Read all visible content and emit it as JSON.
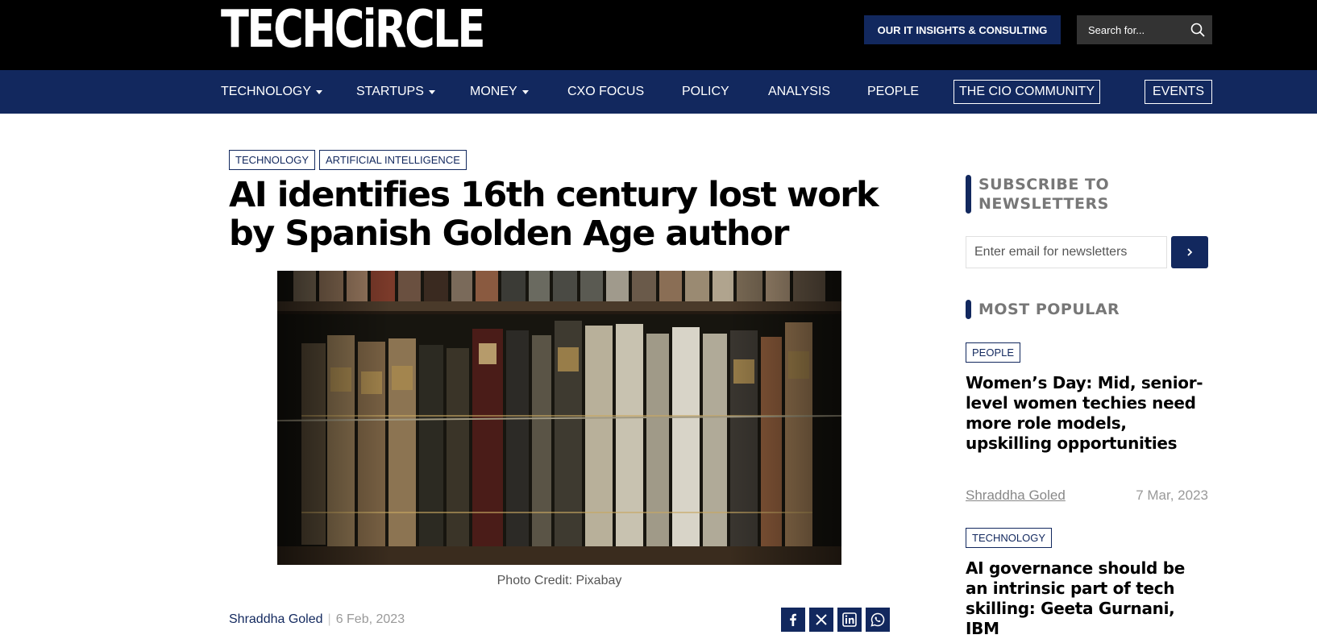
{
  "header": {
    "logo": "TECHCiRCLE",
    "insights_button": "OUR IT INSIGHTS & CONSULTING",
    "search_placeholder": "Search for..."
  },
  "nav": {
    "items": [
      {
        "label": "TECHNOLOGY",
        "dropdown": true
      },
      {
        "label": "STARTUPS",
        "dropdown": true
      },
      {
        "label": "MONEY",
        "dropdown": true
      },
      {
        "label": "CXO FOCUS"
      },
      {
        "label": "POLICY"
      },
      {
        "label": "ANALYSIS"
      },
      {
        "label": "PEOPLE"
      }
    ],
    "cio_community": "THE CIO COMMUNITY",
    "events": "EVENTS"
  },
  "article": {
    "tags": [
      "TECHNOLOGY",
      "ARTIFICIAL INTELLIGENCE"
    ],
    "headline": "AI identifies 16th century lost work by Spanish Golden Age author",
    "photo_credit": "Photo Credit: Pixabay",
    "author": "Shraddha Goled",
    "date": "6 Feb, 2023",
    "share_icons": [
      "facebook-icon",
      "x-icon",
      "linkedin-icon",
      "whatsapp-icon"
    ]
  },
  "sidebar": {
    "subscribe_heading": "SUBSCRIBE TO NEWSLETTERS",
    "email_placeholder": "Enter email for newsletters",
    "most_popular_heading": "MOST POPULAR",
    "popular": [
      {
        "tag": "PEOPLE",
        "title": "Women’s Day: Mid, senior-level women techies need more role models, upskilling opportunities",
        "author": "Shraddha Goled",
        "date": "7 Mar, 2023"
      },
      {
        "tag": "TECHNOLOGY",
        "title": "AI governance should be an intrinsic part of tech skilling: Geeta Gurnani, IBM"
      }
    ]
  },
  "colors": {
    "brand_navy": "#12285e",
    "header_black": "#000000"
  }
}
